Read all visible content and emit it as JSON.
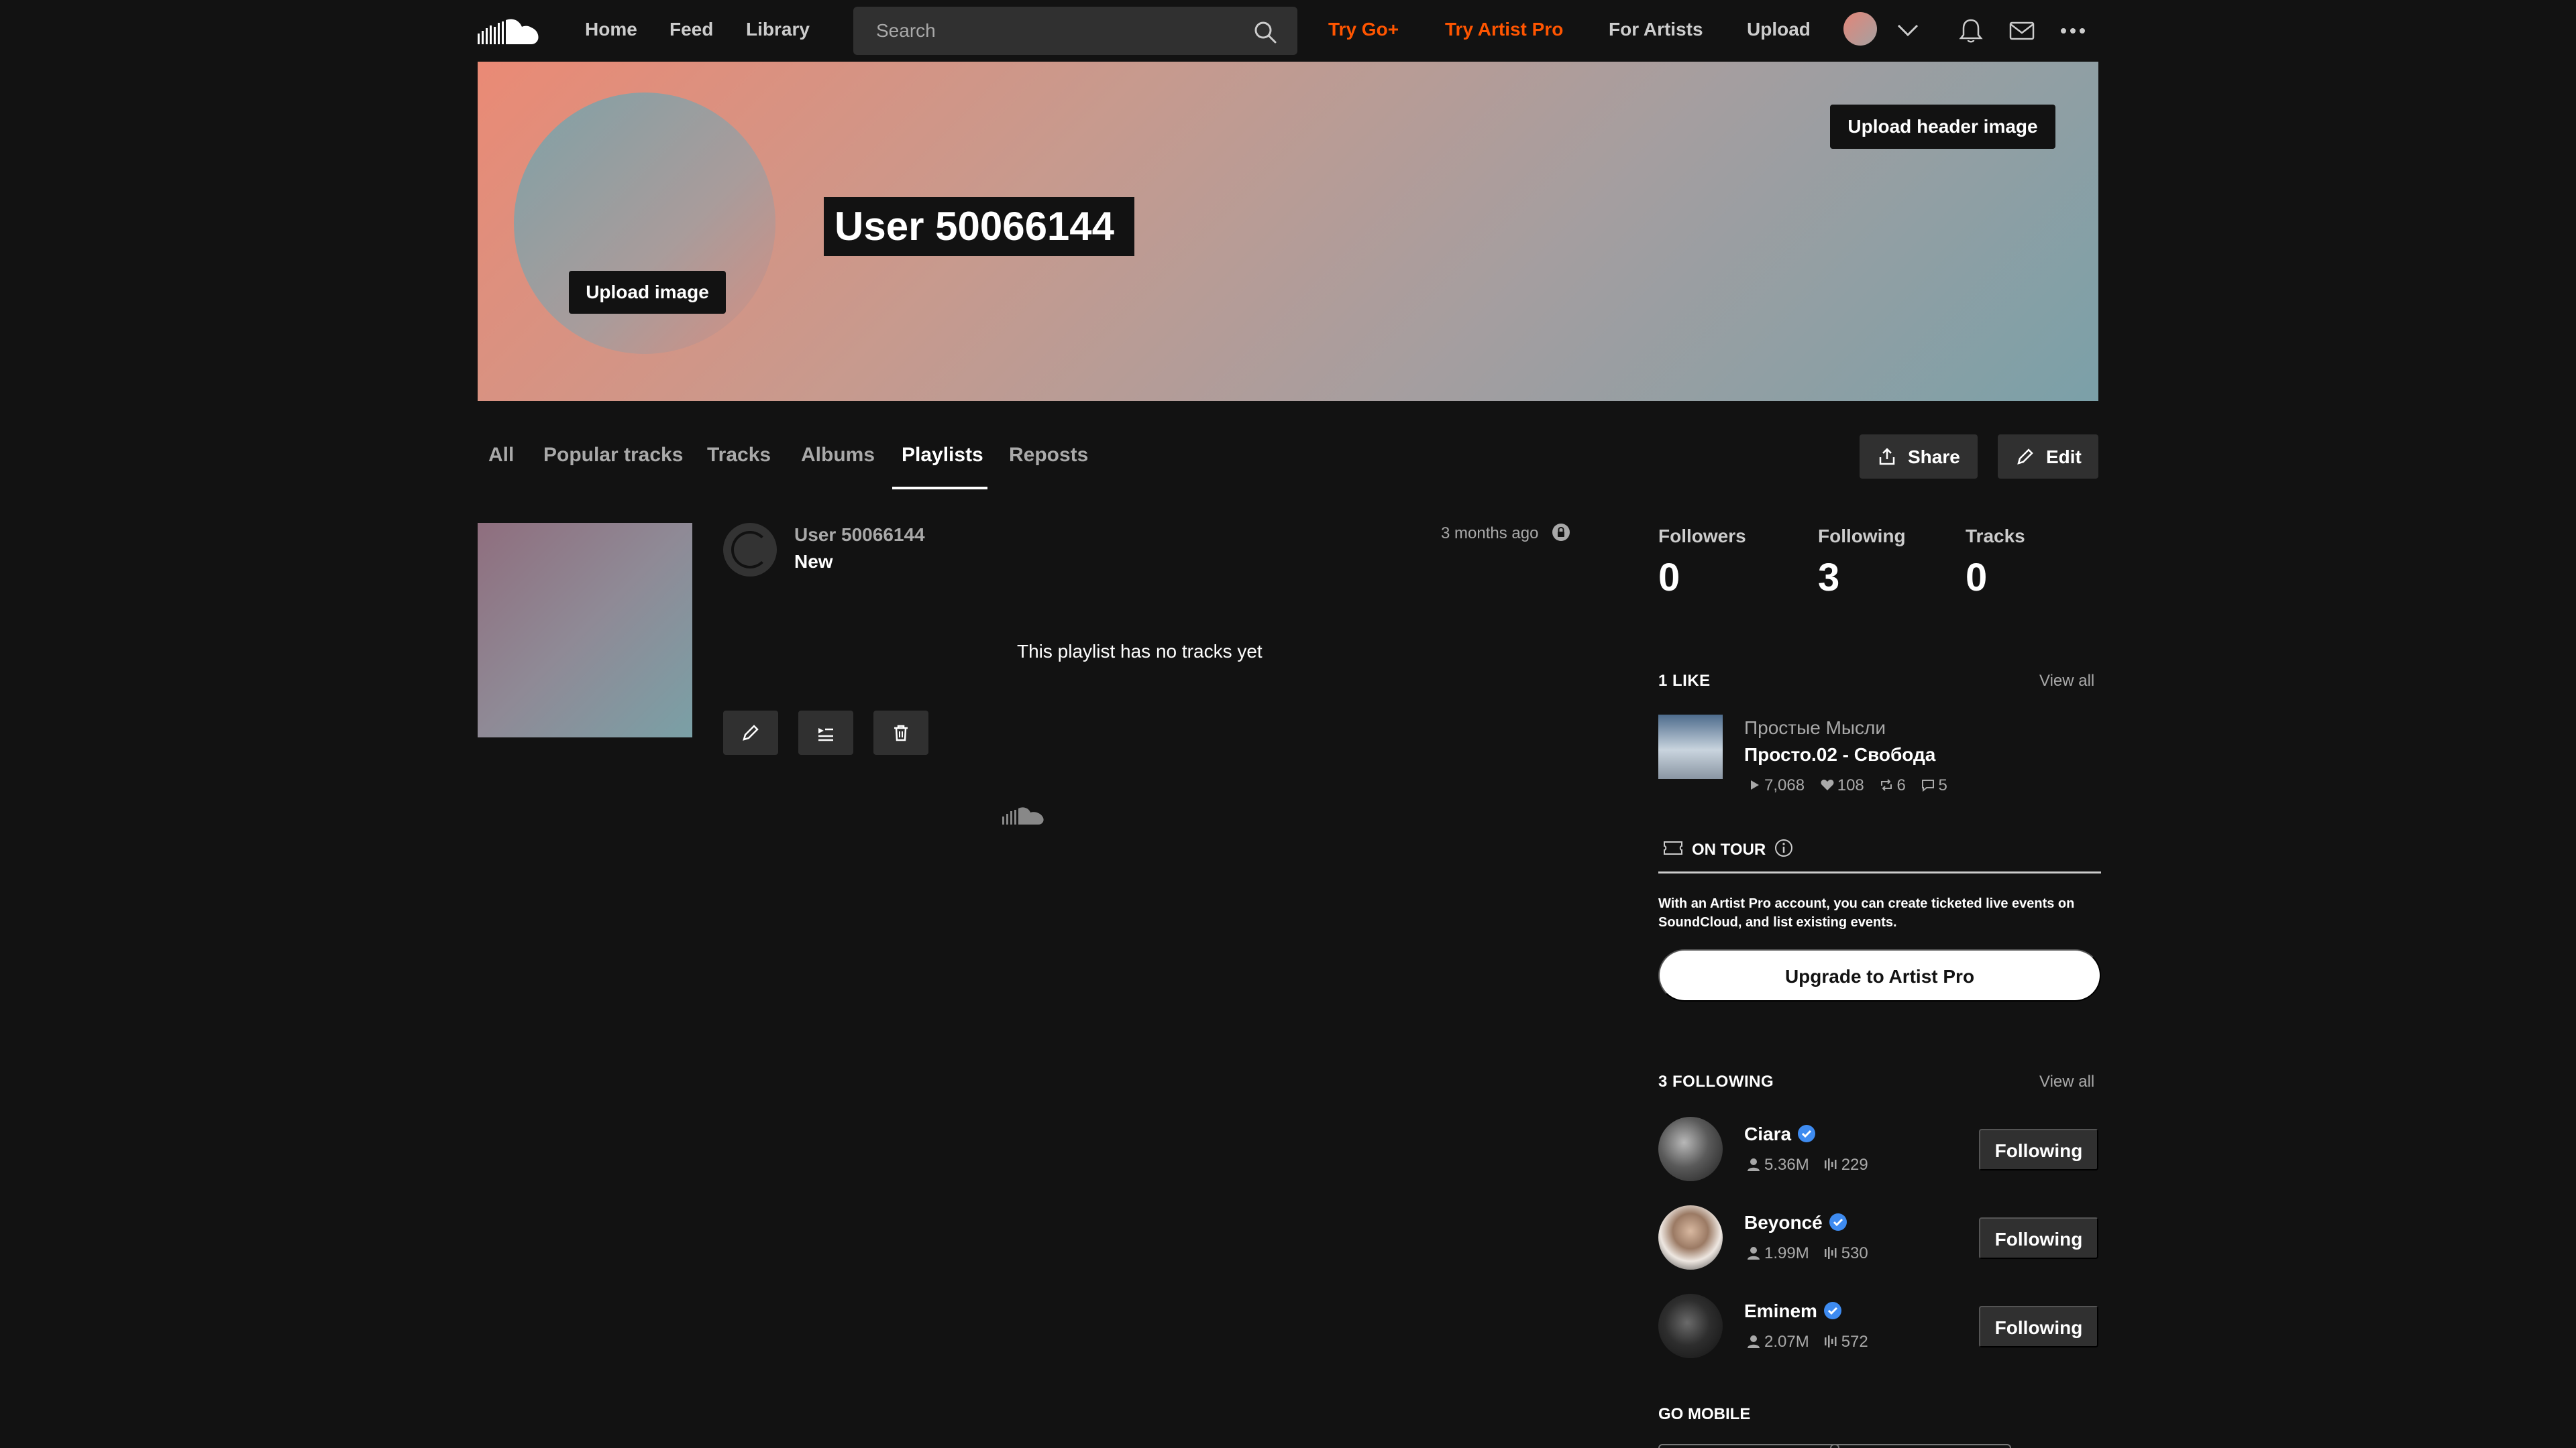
{
  "nav": {
    "logo_icon": "soundcloud-logo-icon",
    "links": [
      "Home",
      "Feed",
      "Library"
    ],
    "search_placeholder": "Search",
    "try_go_plus": "Try Go+",
    "try_artist_pro": "Try Artist Pro",
    "for_artists": "For Artists",
    "upload": "Upload",
    "accent_color": "#ff5500"
  },
  "header": {
    "username": "User 50066144",
    "upload_image_label": "Upload image",
    "upload_header_label": "Upload header image"
  },
  "tabs": {
    "items": [
      "All",
      "Popular tracks",
      "Tracks",
      "Albums",
      "Playlists",
      "Reposts"
    ],
    "active": "Playlists",
    "share_label": "Share",
    "edit_label": "Edit"
  },
  "playlist": {
    "user": "User 50066144",
    "title": "New",
    "time_ago": "3 months ago",
    "empty_message": "This playlist has no tracks yet"
  },
  "stats": {
    "followers_label": "Followers",
    "followers_value": "0",
    "following_label": "Following",
    "following_value": "3",
    "tracks_label": "Tracks",
    "tracks_value": "0"
  },
  "likes": {
    "heading": "1 LIKE",
    "view_all": "View all",
    "item": {
      "artist": "Простые Мысли",
      "track": "Просто.02 - Свобода",
      "plays": "7,068",
      "likes": "108",
      "reposts": "6",
      "comments": "5"
    }
  },
  "on_tour": {
    "label": "ON TOUR",
    "text": "With an Artist Pro account, you can create ticketed live events on SoundCloud, and list existing events.",
    "button": "Upgrade to Artist Pro"
  },
  "following": {
    "heading": "3 FOLLOWING",
    "view_all": "View all",
    "button_label": "Following",
    "verified_color": "#3e8bf0",
    "items": [
      {
        "name": "Ciara",
        "followers": "5.36M",
        "tracks": "229"
      },
      {
        "name": "Beyoncé",
        "followers": "1.99M",
        "tracks": "530"
      },
      {
        "name": "Eminem",
        "followers": "2.07M",
        "tracks": "572"
      }
    ]
  },
  "footer": {
    "go_mobile": "GO MOBILE"
  }
}
